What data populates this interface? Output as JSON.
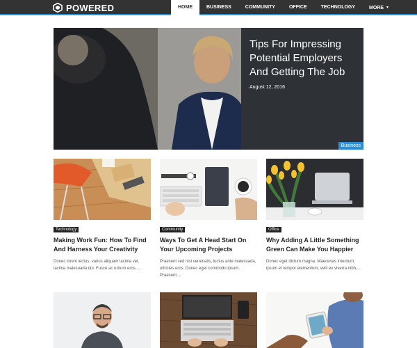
{
  "header": {
    "brand": "POWERED",
    "menu": [
      {
        "label": "HOME",
        "active": true
      },
      {
        "label": "BUSINESS",
        "active": false
      },
      {
        "label": "COMMUNITY",
        "active": false
      },
      {
        "label": "OFFICE",
        "active": false
      },
      {
        "label": "TECHNOLOGY",
        "active": false
      },
      {
        "label": "MORE",
        "active": false
      }
    ]
  },
  "hero": {
    "title": "Tips For Impressing Potential Employers And Getting The Job",
    "date": "August 12, 2016",
    "category": "Business"
  },
  "articles": [
    {
      "category": "Technology",
      "title": "Making Work Fun: How To Find And Harness Your Creativity",
      "excerpt": "Donec lorem lectus, varius aliquam lacinia vel, lacinia malesuada dui. Fusce ac rutrum eros...."
    },
    {
      "category": "Community",
      "title": "Ways To Get A Head Start On Your Upcoming Projects",
      "excerpt": "Praesent sed nisi venenatis, luctus ante malesuada, ultricies eros. Donec eget commodo ipsum. Praesent...."
    },
    {
      "category": "Office",
      "title": "Why Adding A Little Something Green Can Make You Happier",
      "excerpt": "Donec eget dictum magna. Maecenas interdum, ipsum et tempor elementum, velit ex viverra nibh,...."
    }
  ],
  "colors": {
    "accent": "#2a8fd6",
    "nav_bg": "#333333"
  }
}
